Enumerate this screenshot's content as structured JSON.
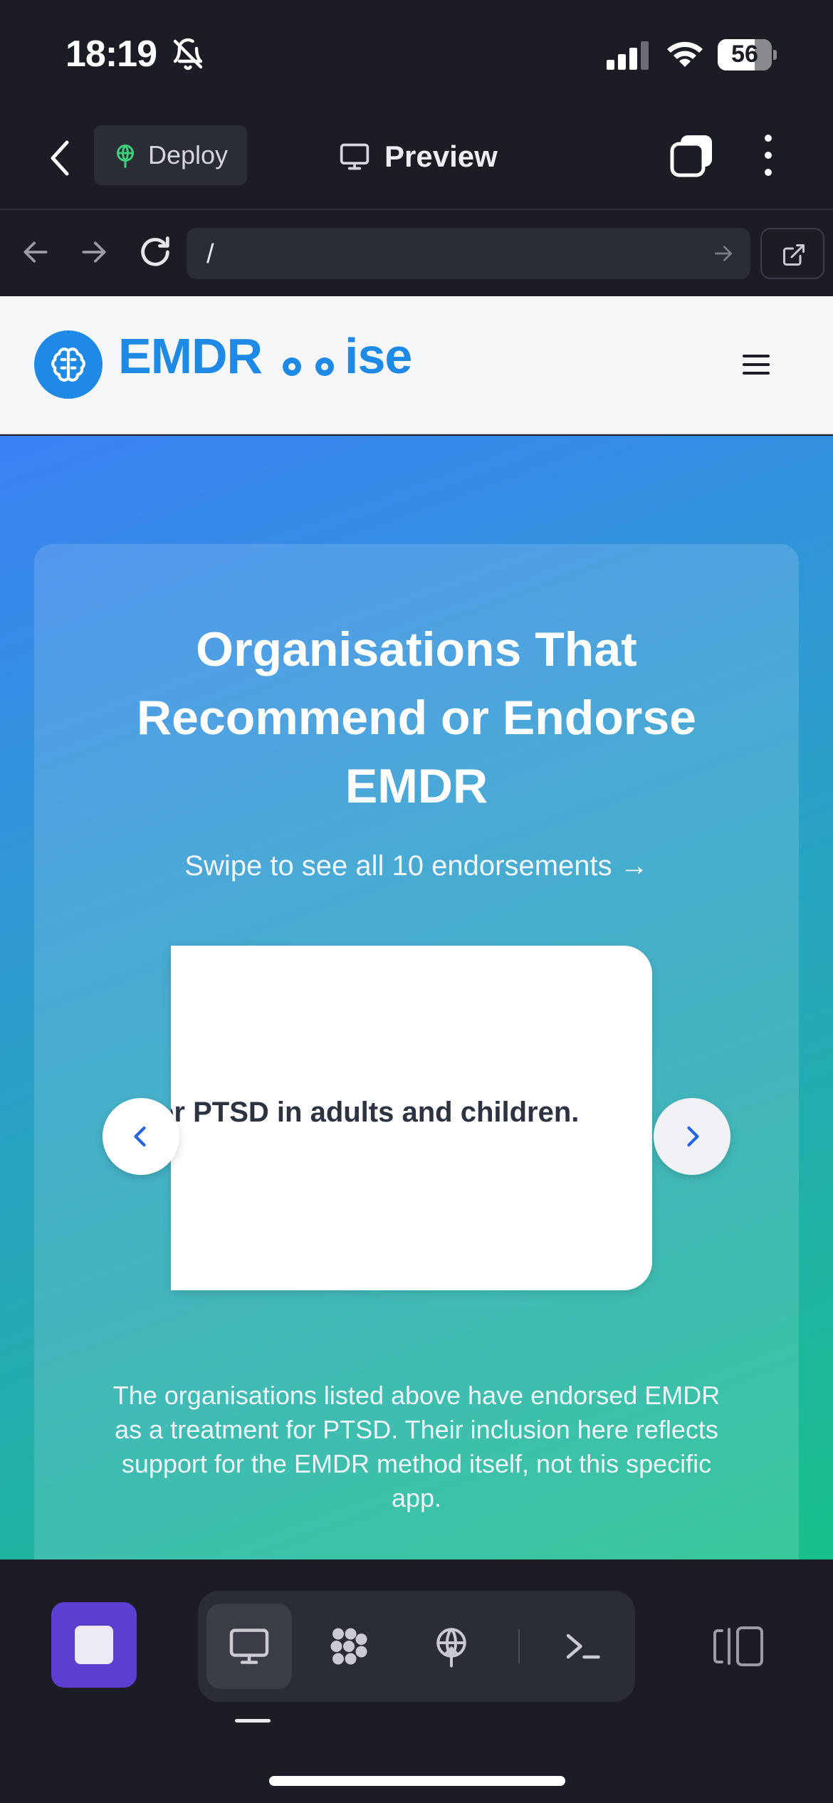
{
  "status_bar": {
    "time": "18:19",
    "battery": "56"
  },
  "toolbar": {
    "deploy_label": "Deploy",
    "preview_label": "Preview"
  },
  "url_bar": {
    "path": "/"
  },
  "site": {
    "logo_left": "EMDR",
    "logo_right": "ise",
    "hero": {
      "title": "Organisations That Recommend or Endorse EMDR",
      "subtitle": "Swipe to see all 10 endorsements →",
      "slide_text": "or PTSD in adults and children.",
      "disclaimer": "The organisations listed above have endorsed EMDR as a treatment for PTSD. Their inclusion here reflects support for the EMDR method itself, not this specific app."
    }
  },
  "colors": {
    "brand": "#1e8ae6",
    "stop_button": "#5b3fd0",
    "gradient_start": "#3b82f6",
    "gradient_end": "#18c08a"
  },
  "icons": [
    "bell-off-icon",
    "signal-icon",
    "wifi-icon",
    "battery-icon",
    "back-chevron-icon",
    "deploy-icon",
    "monitor-icon",
    "tabs-icon",
    "more-vertical-icon",
    "arrow-left-icon",
    "arrow-right-icon",
    "reload-icon",
    "go-arrow-icon",
    "external-link-icon",
    "brain-icon",
    "menu-icon",
    "chevron-left-icon",
    "chevron-right-icon",
    "stop-icon",
    "monitor-icon",
    "puzzle-icon",
    "deploy-icon",
    "terminal-icon",
    "split-view-icon"
  ]
}
